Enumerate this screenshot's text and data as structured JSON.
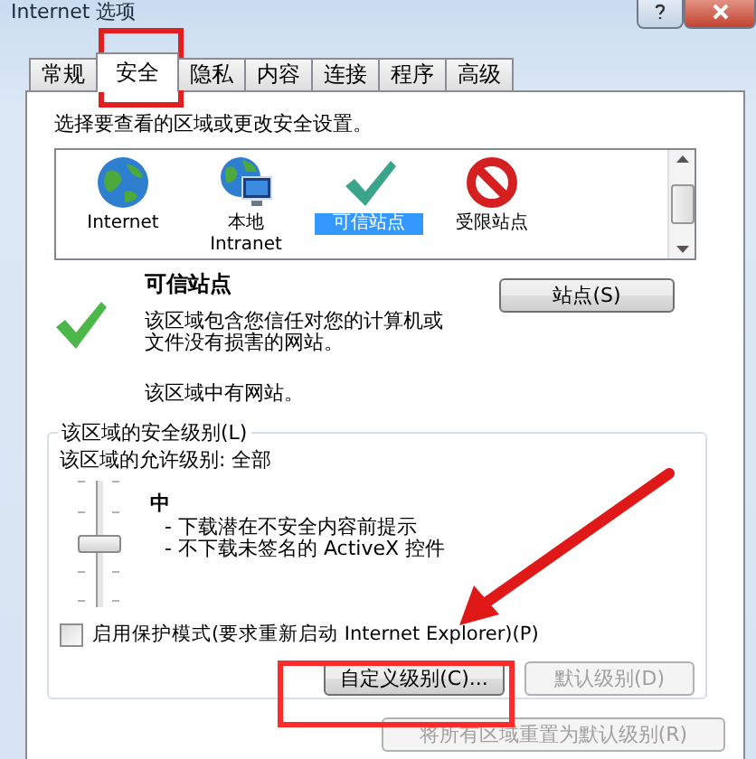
{
  "window": {
    "title": "Internet 选项"
  },
  "tabs": [
    {
      "label": "常规",
      "selected": false
    },
    {
      "label": "安全",
      "selected": true
    },
    {
      "label": "隐私",
      "selected": false
    },
    {
      "label": "内容",
      "selected": false
    },
    {
      "label": "连接",
      "selected": false
    },
    {
      "label": "程序",
      "selected": false
    },
    {
      "label": "高级",
      "selected": false
    }
  ],
  "zone_prompt": "选择要查看的区域或更改安全设置。",
  "zones": [
    {
      "label": "Internet",
      "kind": "globe",
      "selected": false
    },
    {
      "label": "本地 Intranet",
      "kind": "intranet",
      "selected": false
    },
    {
      "label": "可信站点",
      "kind": "trusted",
      "selected": true
    },
    {
      "label": "受限站点",
      "kind": "restricted",
      "selected": false
    }
  ],
  "zone_details": {
    "title": "可信站点",
    "description": "该区域包含您信任对您的计算机或文件没有损害的网站。",
    "status": "该区域中有网站。",
    "sites_button": "站点(S)"
  },
  "security_level": {
    "group_title": "该区域的安全级别(L)",
    "allowed": "该区域的允许级别: 全部",
    "level_name": "中",
    "level": 0.5,
    "bullets": [
      "- 下载潜在不安全内容前提示",
      "- 不下载未签名的 ActiveX 控件"
    ],
    "protected_mode": {
      "label": "启用保护模式(要求重新启动 Internet Explorer)(P)",
      "checked": false
    },
    "buttons": [
      {
        "label": "自定义级别(C)...",
        "disabled": false
      },
      {
        "label": "默认级别(D)",
        "disabled": true
      }
    ]
  },
  "reset_button": {
    "label": "将所有区域重置为默认级别(R)",
    "disabled": true
  }
}
